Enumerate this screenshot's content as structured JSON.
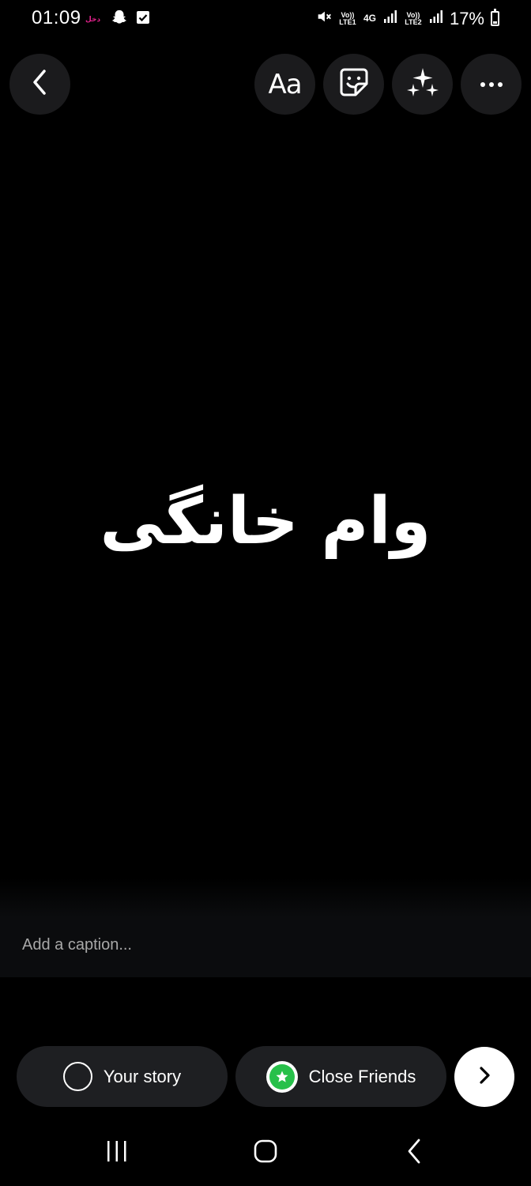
{
  "status_bar": {
    "time": "01:09",
    "notification_badge": "دخل",
    "network_1": "Vo)) LTE1",
    "network_type": "4G",
    "network_2": "Vo)) LTE2",
    "battery": "17%"
  },
  "toolbar": {
    "back": "back",
    "text_tool": "Aa",
    "sticker": "sticker",
    "effects": "effects",
    "more": "more"
  },
  "story": {
    "text": "وام خانگی"
  },
  "caption": {
    "placeholder": "Add a caption..."
  },
  "share": {
    "your_story": "Your story",
    "close_friends": "Close Friends"
  },
  "colors": {
    "background": "#000000",
    "button_bg": "#1b1b1d",
    "pill_bg": "#1e1f22",
    "close_friends_green": "#27c04a",
    "notification_pink": "#e0218a"
  }
}
